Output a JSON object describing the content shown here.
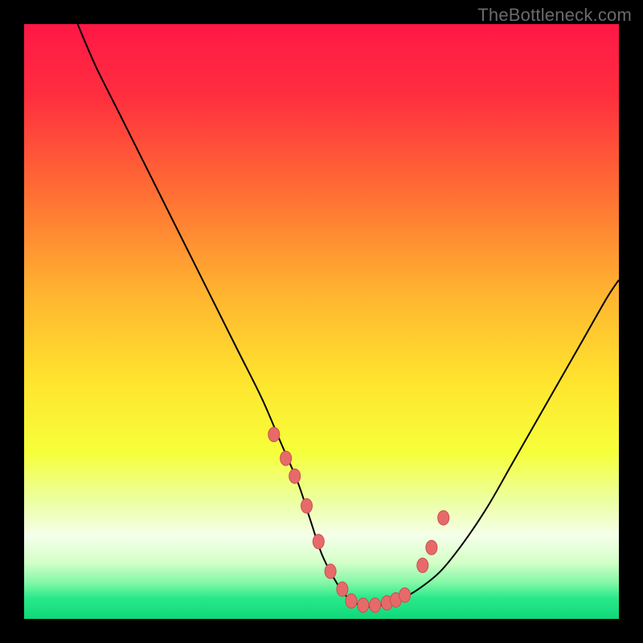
{
  "watermark": "TheBottleneck.com",
  "colors": {
    "frame": "#000000",
    "curve_stroke": "#000000",
    "dot_fill": "#e76a6a",
    "dot_stroke": "#c94f4f",
    "watermark_text": "#6a6a6a",
    "gradient_stops": [
      {
        "offset": 0.0,
        "color": "#ff1846"
      },
      {
        "offset": 0.12,
        "color": "#ff2e3f"
      },
      {
        "offset": 0.28,
        "color": "#ff6d34"
      },
      {
        "offset": 0.45,
        "color": "#ffb330"
      },
      {
        "offset": 0.6,
        "color": "#ffe42e"
      },
      {
        "offset": 0.72,
        "color": "#f6ff3a"
      },
      {
        "offset": 0.8,
        "color": "#ecffa0"
      },
      {
        "offset": 0.86,
        "color": "#f5ffea"
      },
      {
        "offset": 0.905,
        "color": "#d4ffc8"
      },
      {
        "offset": 0.94,
        "color": "#80f7a6"
      },
      {
        "offset": 0.965,
        "color": "#29e98a"
      },
      {
        "offset": 1.0,
        "color": "#0fd879"
      }
    ]
  },
  "chart_data": {
    "type": "line",
    "title": "",
    "xlabel": "",
    "ylabel": "",
    "xlim": [
      0,
      100
    ],
    "ylim": [
      0,
      100
    ],
    "series": [
      {
        "name": "bottleneck-curve",
        "x": [
          9,
          12,
          16,
          20,
          24,
          28,
          32,
          36,
          40,
          43,
          46,
          48,
          50,
          52,
          54,
          56,
          58,
          60,
          63,
          66,
          70,
          74,
          78,
          82,
          86,
          90,
          94,
          98,
          100
        ],
        "y": [
          100,
          93,
          85,
          77,
          69,
          61,
          53,
          45,
          37,
          30,
          23,
          17,
          11,
          7,
          4,
          2.5,
          2,
          2.3,
          3.2,
          4.8,
          8,
          13,
          19,
          26,
          33,
          40,
          47,
          54,
          57
        ]
      }
    ],
    "highlight_points": {
      "name": "trough-markers",
      "x": [
        42,
        44,
        45.5,
        47.5,
        49.5,
        51.5,
        53.5,
        55,
        57,
        59,
        61,
        62.5,
        64,
        67,
        68.5,
        70.5
      ],
      "y": [
        31,
        27,
        24,
        19,
        13,
        8,
        5,
        3,
        2.3,
        2.3,
        2.7,
        3.2,
        4,
        9,
        12,
        17
      ]
    }
  }
}
